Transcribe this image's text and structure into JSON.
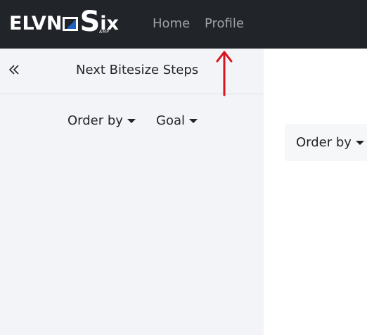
{
  "navbar": {
    "logo": {
      "brand": "ELVN",
      "letter_s": "S",
      "suffix": "ix",
      "amp": "AMP",
      "accent_color": "#1e63c4"
    },
    "links": [
      {
        "label": "Home"
      },
      {
        "label": "Profile"
      }
    ]
  },
  "sidebar": {
    "collapse_icon": "double-chevron-left-icon",
    "title": "Next Bitesize Steps",
    "filters": {
      "order_by": "Order by",
      "goal": "Goal"
    }
  },
  "main": {
    "order_by": "Order by"
  },
  "annotation": {
    "arrow_color": "#d9141f",
    "arrow_icon": "red-up-arrow-icon"
  }
}
